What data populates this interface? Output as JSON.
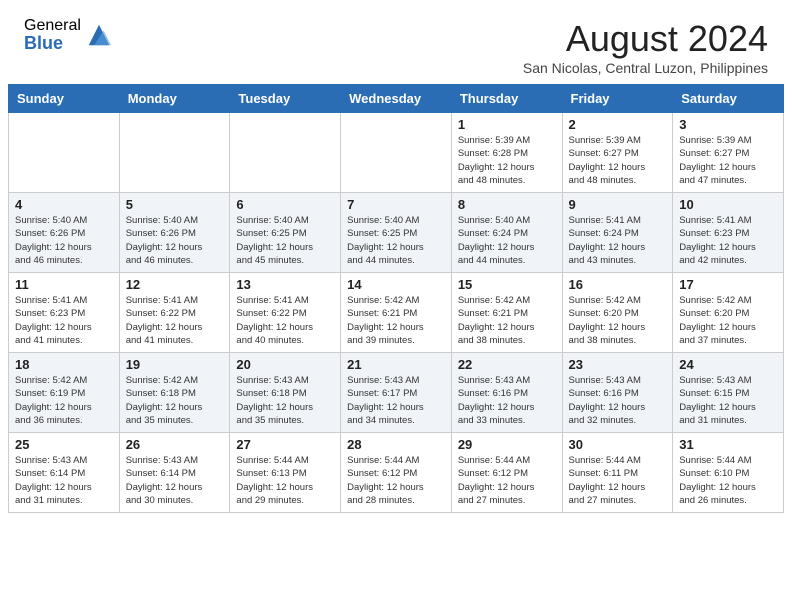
{
  "header": {
    "logo_general": "General",
    "logo_blue": "Blue",
    "month_year": "August 2024",
    "location": "San Nicolas, Central Luzon, Philippines"
  },
  "calendar": {
    "days_of_week": [
      "Sunday",
      "Monday",
      "Tuesday",
      "Wednesday",
      "Thursday",
      "Friday",
      "Saturday"
    ],
    "weeks": [
      [
        {
          "day": "",
          "info": ""
        },
        {
          "day": "",
          "info": ""
        },
        {
          "day": "",
          "info": ""
        },
        {
          "day": "",
          "info": ""
        },
        {
          "day": "1",
          "info": "Sunrise: 5:39 AM\nSunset: 6:28 PM\nDaylight: 12 hours\nand 48 minutes."
        },
        {
          "day": "2",
          "info": "Sunrise: 5:39 AM\nSunset: 6:27 PM\nDaylight: 12 hours\nand 48 minutes."
        },
        {
          "day": "3",
          "info": "Sunrise: 5:39 AM\nSunset: 6:27 PM\nDaylight: 12 hours\nand 47 minutes."
        }
      ],
      [
        {
          "day": "4",
          "info": "Sunrise: 5:40 AM\nSunset: 6:26 PM\nDaylight: 12 hours\nand 46 minutes."
        },
        {
          "day": "5",
          "info": "Sunrise: 5:40 AM\nSunset: 6:26 PM\nDaylight: 12 hours\nand 46 minutes."
        },
        {
          "day": "6",
          "info": "Sunrise: 5:40 AM\nSunset: 6:25 PM\nDaylight: 12 hours\nand 45 minutes."
        },
        {
          "day": "7",
          "info": "Sunrise: 5:40 AM\nSunset: 6:25 PM\nDaylight: 12 hours\nand 44 minutes."
        },
        {
          "day": "8",
          "info": "Sunrise: 5:40 AM\nSunset: 6:24 PM\nDaylight: 12 hours\nand 44 minutes."
        },
        {
          "day": "9",
          "info": "Sunrise: 5:41 AM\nSunset: 6:24 PM\nDaylight: 12 hours\nand 43 minutes."
        },
        {
          "day": "10",
          "info": "Sunrise: 5:41 AM\nSunset: 6:23 PM\nDaylight: 12 hours\nand 42 minutes."
        }
      ],
      [
        {
          "day": "11",
          "info": "Sunrise: 5:41 AM\nSunset: 6:23 PM\nDaylight: 12 hours\nand 41 minutes."
        },
        {
          "day": "12",
          "info": "Sunrise: 5:41 AM\nSunset: 6:22 PM\nDaylight: 12 hours\nand 41 minutes."
        },
        {
          "day": "13",
          "info": "Sunrise: 5:41 AM\nSunset: 6:22 PM\nDaylight: 12 hours\nand 40 minutes."
        },
        {
          "day": "14",
          "info": "Sunrise: 5:42 AM\nSunset: 6:21 PM\nDaylight: 12 hours\nand 39 minutes."
        },
        {
          "day": "15",
          "info": "Sunrise: 5:42 AM\nSunset: 6:21 PM\nDaylight: 12 hours\nand 38 minutes."
        },
        {
          "day": "16",
          "info": "Sunrise: 5:42 AM\nSunset: 6:20 PM\nDaylight: 12 hours\nand 38 minutes."
        },
        {
          "day": "17",
          "info": "Sunrise: 5:42 AM\nSunset: 6:20 PM\nDaylight: 12 hours\nand 37 minutes."
        }
      ],
      [
        {
          "day": "18",
          "info": "Sunrise: 5:42 AM\nSunset: 6:19 PM\nDaylight: 12 hours\nand 36 minutes."
        },
        {
          "day": "19",
          "info": "Sunrise: 5:42 AM\nSunset: 6:18 PM\nDaylight: 12 hours\nand 35 minutes."
        },
        {
          "day": "20",
          "info": "Sunrise: 5:43 AM\nSunset: 6:18 PM\nDaylight: 12 hours\nand 35 minutes."
        },
        {
          "day": "21",
          "info": "Sunrise: 5:43 AM\nSunset: 6:17 PM\nDaylight: 12 hours\nand 34 minutes."
        },
        {
          "day": "22",
          "info": "Sunrise: 5:43 AM\nSunset: 6:16 PM\nDaylight: 12 hours\nand 33 minutes."
        },
        {
          "day": "23",
          "info": "Sunrise: 5:43 AM\nSunset: 6:16 PM\nDaylight: 12 hours\nand 32 minutes."
        },
        {
          "day": "24",
          "info": "Sunrise: 5:43 AM\nSunset: 6:15 PM\nDaylight: 12 hours\nand 31 minutes."
        }
      ],
      [
        {
          "day": "25",
          "info": "Sunrise: 5:43 AM\nSunset: 6:14 PM\nDaylight: 12 hours\nand 31 minutes."
        },
        {
          "day": "26",
          "info": "Sunrise: 5:43 AM\nSunset: 6:14 PM\nDaylight: 12 hours\nand 30 minutes."
        },
        {
          "day": "27",
          "info": "Sunrise: 5:44 AM\nSunset: 6:13 PM\nDaylight: 12 hours\nand 29 minutes."
        },
        {
          "day": "28",
          "info": "Sunrise: 5:44 AM\nSunset: 6:12 PM\nDaylight: 12 hours\nand 28 minutes."
        },
        {
          "day": "29",
          "info": "Sunrise: 5:44 AM\nSunset: 6:12 PM\nDaylight: 12 hours\nand 27 minutes."
        },
        {
          "day": "30",
          "info": "Sunrise: 5:44 AM\nSunset: 6:11 PM\nDaylight: 12 hours\nand 27 minutes."
        },
        {
          "day": "31",
          "info": "Sunrise: 5:44 AM\nSunset: 6:10 PM\nDaylight: 12 hours\nand 26 minutes."
        }
      ]
    ]
  }
}
